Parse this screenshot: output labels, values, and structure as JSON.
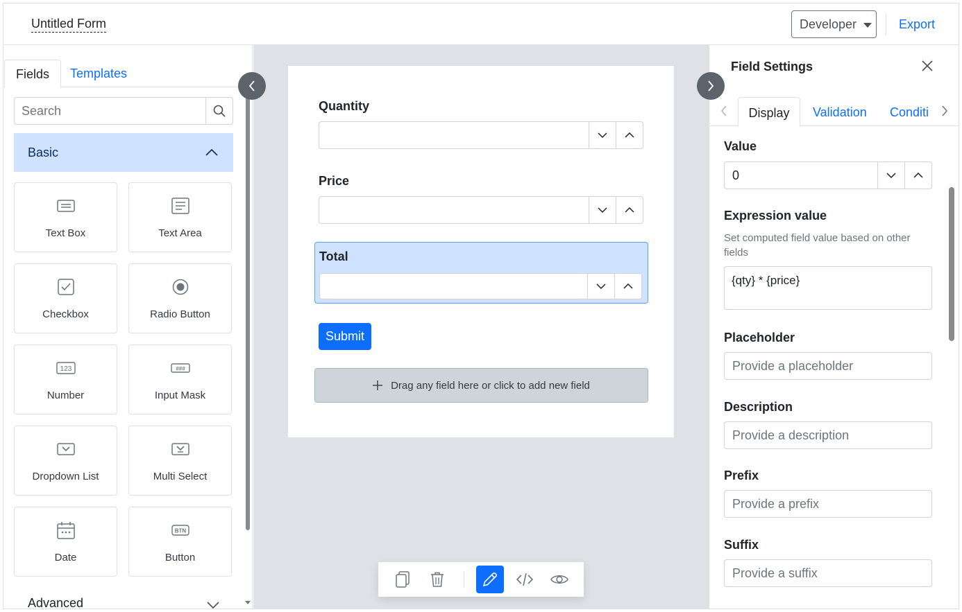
{
  "header": {
    "form_title": "Untitled Form",
    "mode_dropdown": "Developer",
    "export_label": "Export"
  },
  "left_panel": {
    "tabs": [
      "Fields",
      "Templates"
    ],
    "search_placeholder": "Search",
    "section_basic": "Basic",
    "section_advanced": "Advanced",
    "tiles": [
      {
        "label": "Text Box",
        "icon": "textbox-icon"
      },
      {
        "label": "Text Area",
        "icon": "textarea-icon"
      },
      {
        "label": "Checkbox",
        "icon": "checkbox-icon"
      },
      {
        "label": "Radio Button",
        "icon": "radio-icon"
      },
      {
        "label": "Number",
        "icon": "number-icon",
        "icon_text": "123"
      },
      {
        "label": "Input Mask",
        "icon": "input-mask-icon",
        "icon_text": "###"
      },
      {
        "label": "Dropdown List",
        "icon": "dropdown-icon"
      },
      {
        "label": "Multi Select",
        "icon": "multiselect-icon"
      },
      {
        "label": "Date",
        "icon": "calendar-icon"
      },
      {
        "label": "Button",
        "icon": "button-icon",
        "icon_text": "BTN"
      }
    ]
  },
  "canvas": {
    "fields": [
      {
        "label": "Quantity",
        "value": ""
      },
      {
        "label": "Price",
        "value": ""
      },
      {
        "label": "Total",
        "value": ""
      }
    ],
    "submit_label": "Submit",
    "dropzone_text": "Drag any field here or click to add new field"
  },
  "right_panel": {
    "title": "Field Settings",
    "tabs": [
      "Display",
      "Validation",
      "Conditi"
    ],
    "value_label": "Value",
    "value": "0",
    "expression_label": "Expression value",
    "expression_help": "Set computed field value based on other fields",
    "expression_value": "{qty} * {price}",
    "placeholder_label": "Placeholder",
    "placeholder_placeholder": "Provide a placeholder",
    "description_label": "Description",
    "description_placeholder": "Provide a description",
    "prefix_label": "Prefix",
    "prefix_placeholder": "Provide a prefix",
    "suffix_label": "Suffix",
    "suffix_placeholder": "Provide a suffix"
  },
  "colors": {
    "accent": "#0d6efd",
    "selected_bg": "#cfe2ff",
    "canvas_bg": "#dee2e6"
  }
}
